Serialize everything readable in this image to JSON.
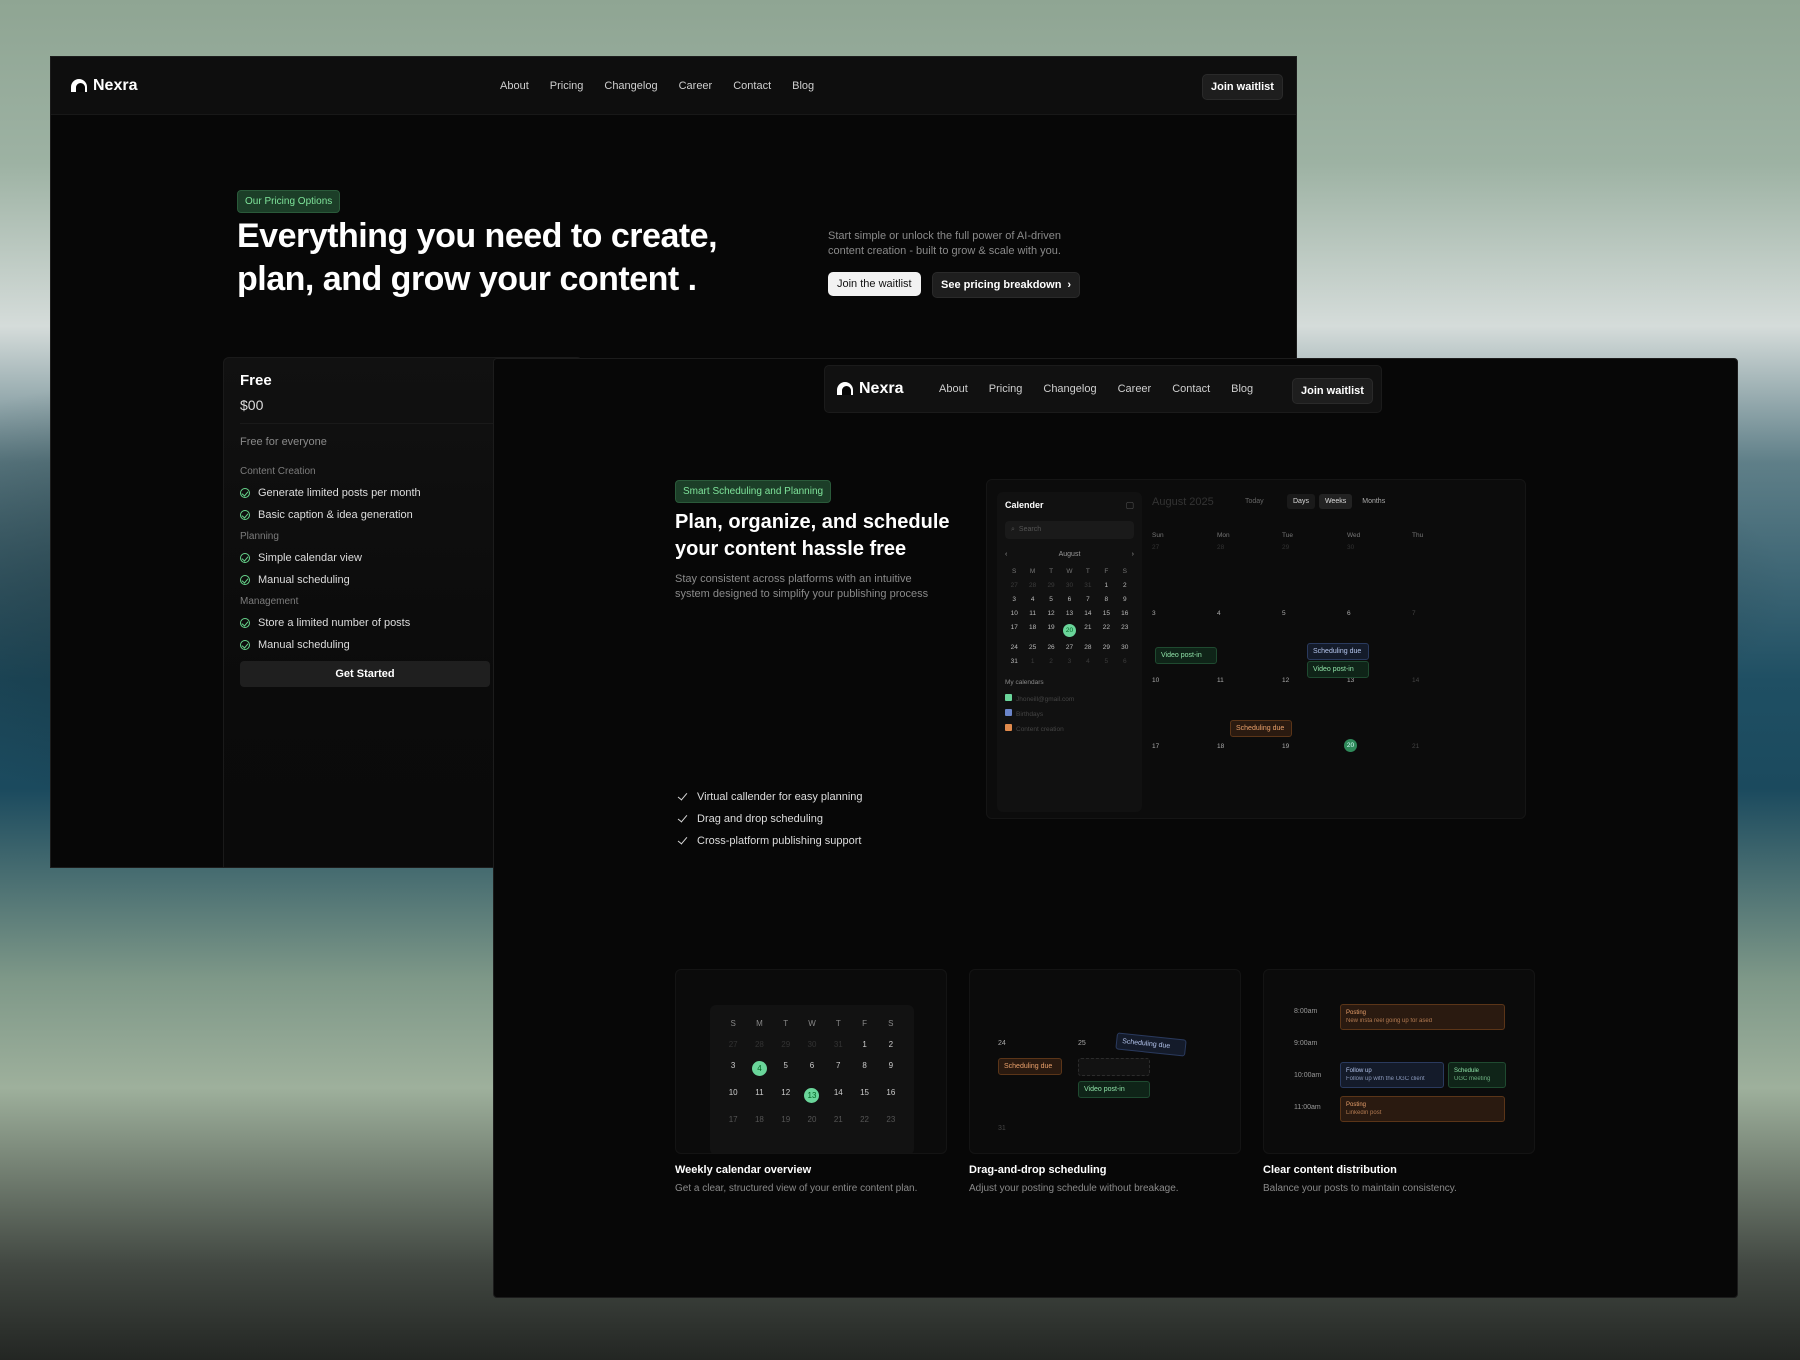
{
  "brand": "Nexra",
  "nav": [
    "About",
    "Pricing",
    "Changelog",
    "Career",
    "Contact",
    "Blog"
  ],
  "join_waitlist": "Join waitlist",
  "pricing_page": {
    "badge": "Our Pricing Options",
    "headline_l1": "Everything you need to create,",
    "headline_l2": "plan, and grow your content .",
    "sub_l1": "Start simple or unlock the full power of AI-driven",
    "sub_l2": "content creation - built to grow & scale with you.",
    "cta_primary": "Join the waitlist",
    "cta_secondary": "See pricing breakdown",
    "free_card": {
      "name": "Free",
      "price": "$00",
      "desc": "Free for everyone",
      "sections": [
        {
          "title": "Content Creation",
          "items": [
            "Generate limited posts per month",
            "Basic caption & idea generation"
          ]
        },
        {
          "title": "Planning",
          "items": [
            "Simple calendar view",
            "Manual scheduling"
          ]
        },
        {
          "title": "Management",
          "items": [
            "Store a limited number of posts",
            "Manual scheduling"
          ]
        }
      ],
      "button": "Get Started"
    }
  },
  "scheduling_page": {
    "badge": "Smart Scheduling and Planning",
    "headline_l1": "Plan, organize, and schedule",
    "headline_l2": "your content hassle free",
    "sub_l1": "Stay consistent across platforms with an intuitive",
    "sub_l2": "system designed to simplify your publishing process",
    "bullets": [
      "Virtual callender for easy planning",
      "Drag and drop scheduling",
      "Cross-platform publishing support"
    ],
    "calendar": {
      "title": "Calender",
      "search_placeholder": "Search",
      "month": "August",
      "header_month": "August 2025",
      "today": "Today",
      "views": [
        "Days",
        "Weeks",
        "Months"
      ],
      "weekday_letters": [
        "S",
        "M",
        "T",
        "W",
        "T",
        "F",
        "S"
      ],
      "day_cols": [
        "Sun",
        "Mon",
        "Tue",
        "Wed",
        "Thu"
      ],
      "mini_rows": [
        [
          "27",
          "28",
          "29",
          "30",
          "31",
          "1",
          "2"
        ],
        [
          "3",
          "4",
          "5",
          "6",
          "7",
          "8",
          "9"
        ],
        [
          "10",
          "11",
          "12",
          "13",
          "14",
          "15",
          "16"
        ],
        [
          "17",
          "18",
          "19",
          "20",
          "21",
          "22",
          "23"
        ],
        [
          "24",
          "25",
          "26",
          "27",
          "28",
          "29",
          "30"
        ],
        [
          "31",
          "1",
          "2",
          "3",
          "4",
          "5",
          "6"
        ]
      ],
      "my_calendars": "My calendars",
      "calendar_list": [
        "Jhoneill@gmail.com",
        "Birthdays",
        "Content creation"
      ],
      "week_rows": [
        [
          "27",
          "28",
          "29",
          "30"
        ],
        [
          "3",
          "4",
          "5",
          "6",
          "7"
        ],
        [
          "10",
          "11",
          "12",
          "13",
          "14"
        ],
        [
          "17",
          "18",
          "19",
          "20",
          "21"
        ]
      ],
      "events": {
        "video_post": "Video post-in",
        "sched_due": "Scheduling due"
      }
    },
    "features": [
      {
        "title": "Weekly calendar overview",
        "desc": "Get a clear, structured view of your entire content plan."
      },
      {
        "title": "Drag-and-drop scheduling",
        "desc": "Adjust your posting schedule without breakage."
      },
      {
        "title": "Clear content distribution",
        "desc": "Balance your posts to maintain consistency."
      }
    ],
    "feature1_grid": {
      "letters": [
        "S",
        "M",
        "T",
        "W",
        "T",
        "F",
        "S"
      ],
      "rows": [
        [
          "27",
          "28",
          "29",
          "30",
          "31",
          "1",
          "2"
        ],
        [
          "3",
          "4",
          "5",
          "6",
          "7",
          "8",
          "9"
        ],
        [
          "10",
          "11",
          "12",
          "13",
          "14",
          "15",
          "16"
        ],
        [
          "17",
          "18",
          "19",
          "20",
          "21",
          "22",
          "23"
        ]
      ]
    },
    "feature2": {
      "day_a": "24",
      "day_b": "25",
      "day_c": "31"
    },
    "feature3": {
      "times": [
        "8:00am",
        "9:00am",
        "10:00am",
        "11:00am"
      ],
      "ev1_title": "Posting",
      "ev1_text": "New insta reel going up for ased",
      "ev2_title": "Follow up",
      "ev2_text": "Follow up with the UGC client",
      "ev3_title": "Schedule",
      "ev3_text": "UGC meeting",
      "ev4_title": "Posting",
      "ev4_text": "Linkedin post"
    }
  },
  "colors": {
    "accent_green": "#6ad59a",
    "bg": "#070707"
  }
}
